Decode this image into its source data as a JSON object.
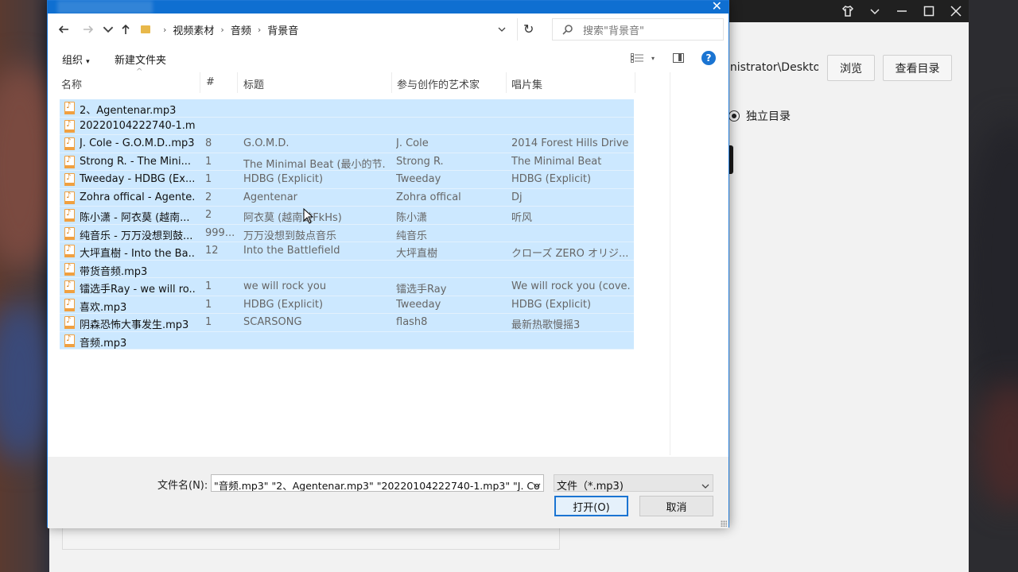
{
  "app": {
    "path_text": "inistrator\\Deskto",
    "browse_label": "浏览",
    "view_dir_label": "查看目录",
    "radio_label": "独立目录"
  },
  "dialog": {
    "title": "",
    "breadcrumbs": [
      "视频素材",
      "音频",
      "背景音"
    ],
    "search_placeholder": "搜索\"背景音\"",
    "toolbar": {
      "organize_label": "组织",
      "new_folder_label": "新建文件夹"
    },
    "columns": {
      "name": "名称",
      "track": "#",
      "title": "标题",
      "artist": "参与创作的艺术家",
      "album": "唱片集"
    },
    "files": [
      {
        "name": "2、Agentenar.mp3",
        "track": "",
        "title": "",
        "artist": "",
        "album": ""
      },
      {
        "name": "20220104222740-1.m...",
        "track": "",
        "title": "",
        "artist": "",
        "album": ""
      },
      {
        "name": "J. Cole - G.O.M.D..mp3",
        "track": "8",
        "title": "G.O.M.D.",
        "artist": "J. Cole",
        "album": "2014 Forest Hills Drive"
      },
      {
        "name": "Strong R. - The Mini...",
        "track": "1",
        "title": "The Minimal Beat (最小的节...",
        "artist": "Strong R.",
        "album": "The Minimal Beat"
      },
      {
        "name": "Tweeday - HDBG (Ex...",
        "track": "1",
        "title": "HDBG (Explicit)",
        "artist": "Tweeday",
        "album": "HDBG (Explicit)"
      },
      {
        "name": "Zohra offical - Agente...",
        "track": "2",
        "title": "Agentenar",
        "artist": "Zohra offical",
        "album": "Dj"
      },
      {
        "name": "陈小潇 - 阿衣莫 (越南...",
        "track": "2",
        "title": "阿衣莫 (越南鼓FkHs)",
        "artist": "陈小潇",
        "album": "听风"
      },
      {
        "name": "纯音乐 - 万万没想到鼓...",
        "track": "999...",
        "title": "万万没想到鼓点音乐",
        "artist": "纯音乐",
        "album": ""
      },
      {
        "name": "大坪直樹 - Into the Ba...",
        "track": "12",
        "title": "Into the Battlefield",
        "artist": "大坪直樹",
        "album": "クローズ ZERO オリジ..."
      },
      {
        "name": "带货音频.mp3",
        "track": "",
        "title": "",
        "artist": "",
        "album": ""
      },
      {
        "name": "镭选手Ray - we will ro...",
        "track": "1",
        "title": "we will rock you",
        "artist": "镭选手Ray",
        "album": "We will rock you (cove..."
      },
      {
        "name": "喜欢.mp3",
        "track": "1",
        "title": "HDBG (Explicit)",
        "artist": "Tweeday",
        "album": "HDBG (Explicit)"
      },
      {
        "name": "阴森恐怖大事发生.mp3",
        "track": "1",
        "title": "SCARSONG",
        "artist": "flash8",
        "album": "最新热歌慢摇3"
      },
      {
        "name": "音频.mp3",
        "track": "",
        "title": "",
        "artist": "",
        "album": ""
      }
    ],
    "filename_label": "文件名(N):",
    "filename_value": "\"音频.mp3\" \"2、Agentenar.mp3\" \"20220104222740-1.mp3\" \"J. Co",
    "filetype_value": "文件（*.mp3)",
    "open_label": "打开(O)",
    "cancel_label": "取消"
  },
  "colors": {
    "selection": "#cce8ff",
    "accent": "#1a74d2",
    "titlebar": "#0f6fd1"
  }
}
